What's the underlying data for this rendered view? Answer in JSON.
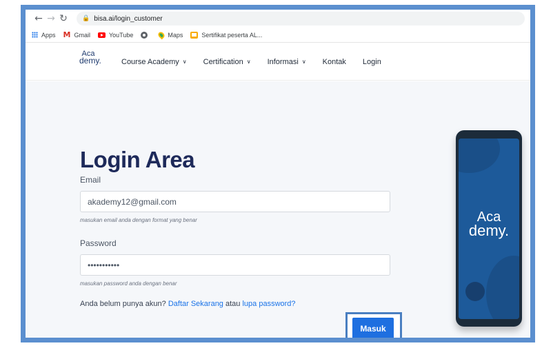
{
  "browser": {
    "url": "bisa.ai/login_customer",
    "nav_icons": [
      "back-arrow-icon",
      "forward-arrow-icon",
      "reload-icon",
      "lock-icon"
    ],
    "bookmarks": [
      {
        "label": "Apps",
        "icon": "apps-grid-icon"
      },
      {
        "label": "Gmail",
        "icon": "gmail-icon"
      },
      {
        "label": "YouTube",
        "icon": "youtube-icon"
      },
      {
        "label": "",
        "icon": "chrome-icon"
      },
      {
        "label": "Maps",
        "icon": "maps-pin-icon"
      },
      {
        "label": "Sertifikat peserta AL...",
        "icon": "certificate-icon"
      }
    ]
  },
  "site": {
    "logo": {
      "line1": "Aca",
      "line2": "demy."
    },
    "menu": [
      {
        "label": "Course Academy",
        "has_dropdown": true
      },
      {
        "label": "Certification",
        "has_dropdown": true
      },
      {
        "label": "Informasi",
        "has_dropdown": true
      },
      {
        "label": "Kontak",
        "has_dropdown": false
      },
      {
        "label": "Login",
        "has_dropdown": false
      }
    ]
  },
  "login": {
    "title": "Login Area",
    "email_label": "Email",
    "email_value": "akademy12@gmail.com",
    "email_hint": "masukan email anda dengan format yang benar",
    "password_label": "Password",
    "password_value": "•••••••••••",
    "password_hint": "masukan password anda dengan benar",
    "signup_prefix": "Anda belum punya akun?",
    "signup_link": "Daftar Sekarang",
    "signup_middle": "atau",
    "forgot_link": "lupa password?",
    "submit_label": "Masuk"
  },
  "phone_logo": {
    "line1": "Aca",
    "line2": "demy."
  },
  "colors": {
    "frame": "#5b8fcf",
    "primary_button": "#1e6fe0",
    "title": "#1e2a5a",
    "phone_screen": "#1d5a9a",
    "link": "#1a73e8"
  }
}
